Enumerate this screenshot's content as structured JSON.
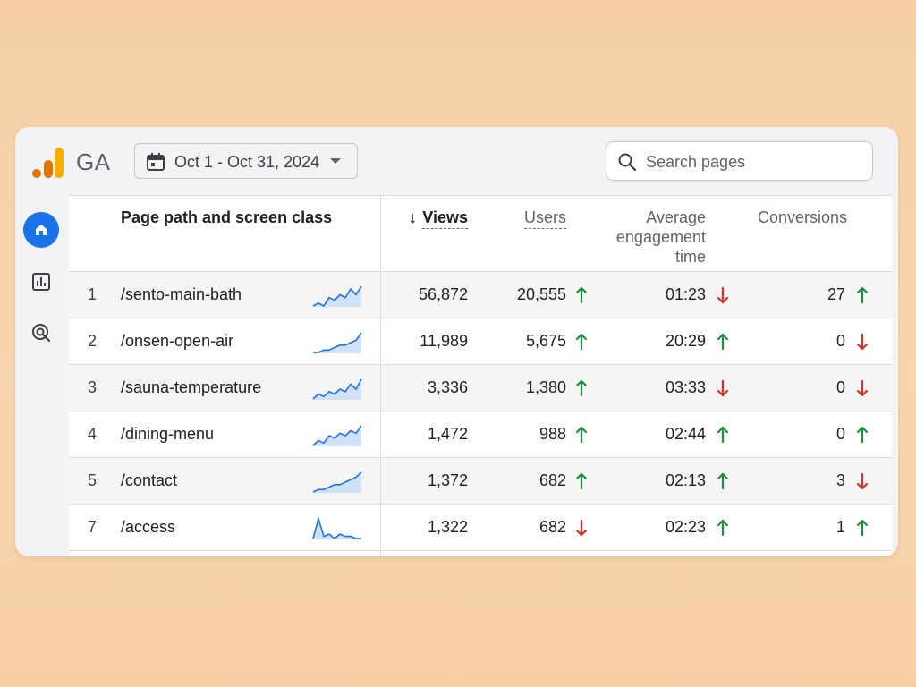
{
  "app": {
    "brand": "GA"
  },
  "date_range": {
    "label": "Oct 1 - Oct 31, 2024"
  },
  "search": {
    "placeholder": "Search pages",
    "value": ""
  },
  "colors": {
    "up": "#1e8e3e",
    "down": "#d93025",
    "accent": "#1a73e8"
  },
  "sidebar": {
    "items": [
      {
        "icon": "home-icon",
        "active": true
      },
      {
        "icon": "reports-icon",
        "active": false
      },
      {
        "icon": "explore-icon",
        "active": false
      }
    ]
  },
  "table": {
    "headers": {
      "page": "Page path and screen class",
      "views": "Views",
      "views_sort": "↓",
      "users": "Users",
      "engagement": "Average engagement time",
      "conversions": "Conversions"
    },
    "rows": [
      {
        "rank": "1",
        "path": "/sento-main-bath",
        "views": "56,872",
        "users": "20,555",
        "users_trend": "up",
        "engagement": "01:23",
        "engagement_trend": "down",
        "conversions": "27",
        "conversions_trend": "up",
        "spark": [
          3,
          4,
          3,
          6,
          5,
          7,
          6,
          9,
          7,
          10
        ]
      },
      {
        "rank": "2",
        "path": "/onsen-open-air",
        "views": "11,989",
        "users": "5,675",
        "users_trend": "up",
        "engagement": "20:29",
        "engagement_trend": "up",
        "conversions": "0",
        "conversions_trend": "down",
        "spark": [
          2,
          2,
          3,
          3,
          4,
          5,
          5,
          6,
          7,
          10
        ]
      },
      {
        "rank": "3",
        "path": "/sauna-temperature",
        "views": "3,336",
        "users": "1,380",
        "users_trend": "up",
        "engagement": "03:33",
        "engagement_trend": "down",
        "conversions": "0",
        "conversions_trend": "down",
        "spark": [
          2,
          4,
          3,
          5,
          4,
          6,
          5,
          8,
          6,
          10
        ]
      },
      {
        "rank": "4",
        "path": "/dining-menu",
        "views": "1,472",
        "users": "988",
        "users_trend": "up",
        "engagement": "02:44",
        "engagement_trend": "up",
        "conversions": "0",
        "conversions_trend": "up",
        "spark": [
          2,
          4,
          3,
          6,
          5,
          7,
          6,
          8,
          7,
          10
        ]
      },
      {
        "rank": "5",
        "path": "/contact",
        "views": "1,372",
        "users": "682",
        "users_trend": "up",
        "engagement": "02:13",
        "engagement_trend": "up",
        "conversions": "3",
        "conversions_trend": "down",
        "spark": [
          2,
          3,
          3,
          4,
          5,
          5,
          6,
          7,
          8,
          10
        ]
      },
      {
        "rank": "7",
        "path": "/access",
        "views": "1,322",
        "users": "682",
        "users_trend": "down",
        "engagement": "02:23",
        "engagement_trend": "up",
        "conversions": "1",
        "conversions_trend": "up",
        "spark": [
          1,
          10,
          2,
          3,
          1,
          3,
          2,
          2,
          1,
          1
        ]
      }
    ]
  }
}
